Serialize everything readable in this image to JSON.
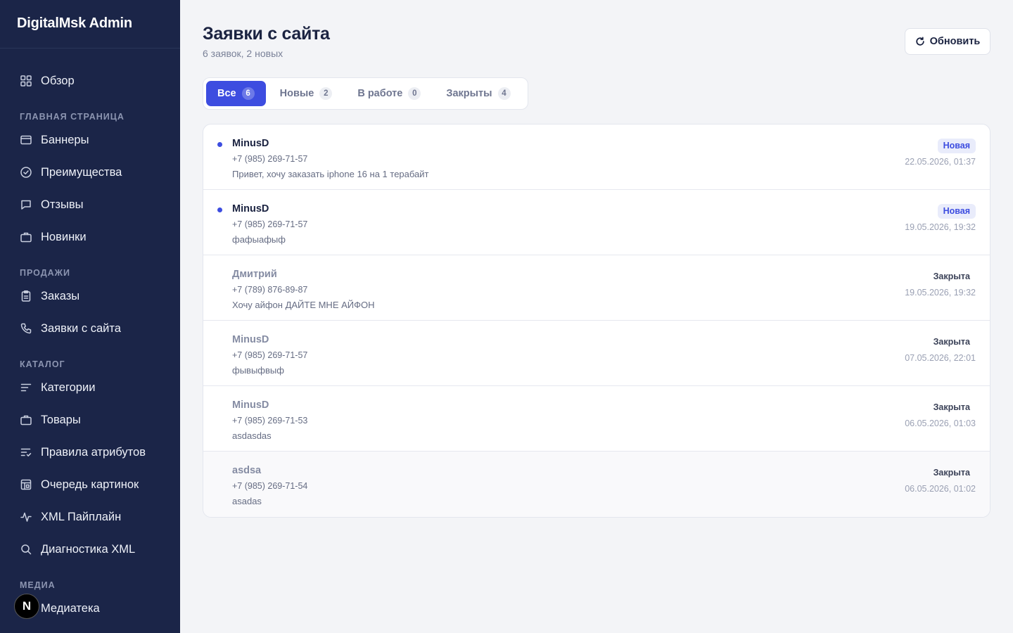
{
  "sidebar": {
    "brand": "DigitalMsk Admin",
    "overview": {
      "label": "Обзор",
      "icon": "grid-icon"
    },
    "sections": [
      {
        "title": "ГЛАВНАЯ СТРАНИЦА",
        "items": [
          {
            "label": "Баннеры",
            "icon": "card-icon"
          },
          {
            "label": "Преимущества",
            "icon": "check-circle-icon"
          },
          {
            "label": "Отзывы",
            "icon": "message-icon"
          },
          {
            "label": "Новинки",
            "icon": "briefcase-icon"
          }
        ]
      },
      {
        "title": "ПРОДАЖИ",
        "items": [
          {
            "label": "Заказы",
            "icon": "clipboard-icon"
          },
          {
            "label": "Заявки с сайта",
            "icon": "phone-icon"
          }
        ]
      },
      {
        "title": "КАТАЛОГ",
        "items": [
          {
            "label": "Категории",
            "icon": "lines-icon"
          },
          {
            "label": "Товары",
            "icon": "briefcase-icon"
          },
          {
            "label": "Правила атрибутов",
            "icon": "list-check-icon"
          },
          {
            "label": "Очередь картинок",
            "icon": "image-queue-icon"
          },
          {
            "label": "XML Пайплайн",
            "icon": "activity-icon"
          },
          {
            "label": "Диагностика XML",
            "icon": "search-icon"
          }
        ]
      },
      {
        "title": "МЕДИА",
        "items": [
          {
            "label": "Медиатека",
            "icon": "image-icon"
          }
        ]
      }
    ],
    "dev_badge": "N"
  },
  "header": {
    "title": "Заявки с сайта",
    "subtitle": "6 заявок, 2 новых",
    "refresh_label": "Обновить"
  },
  "tabs": [
    {
      "label": "Все",
      "count": "6",
      "active": true
    },
    {
      "label": "Новые",
      "count": "2",
      "active": false
    },
    {
      "label": "В работе",
      "count": "0",
      "active": false
    },
    {
      "label": "Закрыты",
      "count": "4",
      "active": false
    }
  ],
  "requests": [
    {
      "name": "MinusD",
      "phone": "+7 (985) 269-71-57",
      "message": "Привет, хочу заказать iphone 16 на 1 терабайт",
      "status": "Новая",
      "date": "22.05.2026, 01:37",
      "is_new": true
    },
    {
      "name": "MinusD",
      "phone": "+7 (985) 269-71-57",
      "message": "фафыафыф",
      "status": "Новая",
      "date": "19.05.2026, 19:32",
      "is_new": true
    },
    {
      "name": "Дмитрий",
      "phone": "+7 (789) 876-89-87",
      "message": "Хочу айфон ДАЙТЕ МНЕ АЙФОН",
      "status": "Закрыта",
      "date": "19.05.2026, 19:32",
      "is_new": false
    },
    {
      "name": "MinusD",
      "phone": "+7 (985) 269-71-57",
      "message": "фывыфвыф",
      "status": "Закрыта",
      "date": "07.05.2026, 22:01",
      "is_new": false
    },
    {
      "name": "MinusD",
      "phone": "+7 (985) 269-71-53",
      "message": "asdasdas",
      "status": "Закрыта",
      "date": "06.05.2026, 01:03",
      "is_new": false
    },
    {
      "name": "asdsa",
      "phone": "+7 (985) 269-71-54",
      "message": "asadas",
      "status": "Закрыта",
      "date": "06.05.2026, 01:02",
      "is_new": false
    }
  ],
  "colors": {
    "sidebar_bg": "#1b2548",
    "accent": "#3d4de0",
    "page_bg": "#f3f4f7"
  }
}
